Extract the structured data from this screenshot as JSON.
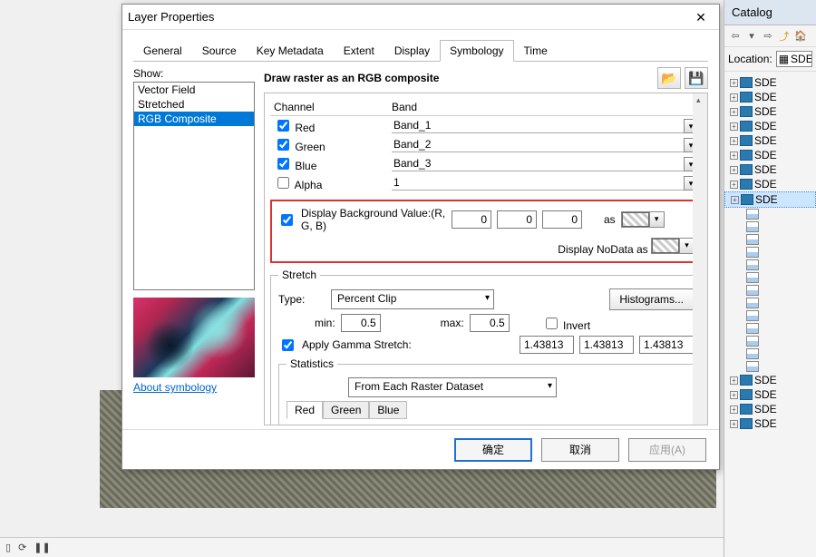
{
  "dialog": {
    "title": "Layer Properties",
    "tabs": [
      "General",
      "Source",
      "Key Metadata",
      "Extent",
      "Display",
      "Symbology",
      "Time"
    ],
    "active_tab": 5,
    "show_label": "Show:",
    "show_items": [
      "Vector Field",
      "Stretched",
      "RGB Composite"
    ],
    "show_selected": 2,
    "about_link": "About symbology",
    "draw_header": "Draw raster as an RGB composite",
    "open_icon": "📂",
    "save_icon": "💾",
    "channel_header": "Channel",
    "band_header": "Band",
    "channels": [
      {
        "name": "Red",
        "checked": true,
        "band": "Band_1"
      },
      {
        "name": "Green",
        "checked": true,
        "band": "Band_2"
      },
      {
        "name": "Blue",
        "checked": true,
        "band": "Band_3"
      },
      {
        "name": "Alpha",
        "checked": false,
        "band": "1"
      }
    ],
    "bg_checked": true,
    "bg_label": "Display Background Value:(R, G, B)",
    "bg_r": "0",
    "bg_g": "0",
    "bg_b": "0",
    "bg_as_label": "as",
    "nodata_label": "Display NoData as",
    "stretch_legend": "Stretch",
    "stretch_type_label": "Type:",
    "stretch_type_value": "Percent Clip",
    "histograms_btn": "Histograms...",
    "min_label": "min:",
    "min_val": "0.5",
    "max_label": "max:",
    "max_val": "0.5",
    "invert_label": "Invert",
    "invert_checked": false,
    "gamma_checked": true,
    "gamma_label": "Apply Gamma Stretch:",
    "gamma_r": "1.43813",
    "gamma_g": "1.43813",
    "gamma_b": "1.43813",
    "stats_legend": "Statistics",
    "stats_value": "From Each Raster Dataset",
    "stats_tabs": [
      "Red",
      "Green",
      "Blue"
    ],
    "ok_btn": "确定",
    "cancel_btn": "取消",
    "apply_btn": "应用(A)"
  },
  "catalog": {
    "title": "Catalog",
    "location_label": "Location:",
    "location_value": "SDE.",
    "tree": [
      {
        "kind": "sde",
        "label": "SDE"
      },
      {
        "kind": "sde",
        "label": "SDE"
      },
      {
        "kind": "sde",
        "label": "SDE"
      },
      {
        "kind": "sde",
        "label": "SDE"
      },
      {
        "kind": "sde",
        "label": "SDE"
      },
      {
        "kind": "sde",
        "label": "SDE"
      },
      {
        "kind": "sde",
        "label": "SDE"
      },
      {
        "kind": "sde",
        "label": "SDE"
      },
      {
        "kind": "sde",
        "label": "SDE",
        "selected": true
      },
      {
        "kind": "raster"
      },
      {
        "kind": "raster"
      },
      {
        "kind": "raster"
      },
      {
        "kind": "raster"
      },
      {
        "kind": "raster"
      },
      {
        "kind": "raster"
      },
      {
        "kind": "raster"
      },
      {
        "kind": "raster"
      },
      {
        "kind": "raster"
      },
      {
        "kind": "raster"
      },
      {
        "kind": "raster"
      },
      {
        "kind": "raster"
      },
      {
        "kind": "raster"
      },
      {
        "kind": "sde",
        "label": "SDE"
      },
      {
        "kind": "sde",
        "label": "SDE"
      },
      {
        "kind": "sde",
        "label": "SDE"
      },
      {
        "kind": "sde",
        "label": "SDE"
      }
    ]
  }
}
